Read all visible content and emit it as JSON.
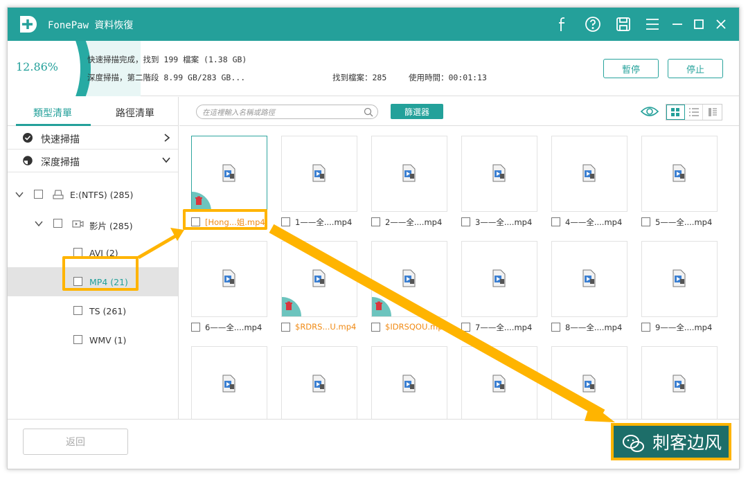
{
  "app": {
    "title": "FonePaw 資料恢復"
  },
  "titlebar": {
    "icons": [
      "facebook-icon",
      "help-icon",
      "save-icon",
      "menu-icon",
      "minimize-icon",
      "maximize-icon",
      "close-icon"
    ]
  },
  "status": {
    "percent": "12.86%",
    "line1": "快速掃描完成，找到 199 檔案 (1.38 GB)",
    "line2": "深度掃描，第二階段 8.99 GB/283 GB...",
    "found_label": "找到檔案：285",
    "time_label": "使用時間：00:01:13",
    "pause": "暫停",
    "stop": "停止"
  },
  "sidebar": {
    "tabs": [
      "類型清單",
      "路徑清單"
    ],
    "quick_scan": "快速掃描",
    "deep_scan": "深度掃描",
    "drive": "E:(NTFS) (285)",
    "video": "影片 (285)",
    "types": [
      "AVI (2)",
      "MP4 (21)",
      "TS (261)",
      "WMV (1)"
    ]
  },
  "toolbar": {
    "search_placeholder": "在這裡輸入名稱或路徑",
    "filter": "篩選器"
  },
  "files": [
    {
      "name": "[Hong...姐.mp4",
      "deleted": true,
      "orange": true
    },
    {
      "name": "1——全....mp4",
      "deleted": false,
      "orange": false
    },
    {
      "name": "2——全....mp4",
      "deleted": false,
      "orange": false
    },
    {
      "name": "3——全....mp4",
      "deleted": false,
      "orange": false
    },
    {
      "name": "4——全....mp4",
      "deleted": false,
      "orange": false
    },
    {
      "name": "5——全....mp4",
      "deleted": false,
      "orange": false
    },
    {
      "name": "6——全....mp4",
      "deleted": false,
      "orange": false
    },
    {
      "name": "$RDRS...U.mp4",
      "deleted": true,
      "orange": true
    },
    {
      "name": "$IDRSQOU.mp4",
      "deleted": true,
      "orange": true
    },
    {
      "name": "7——全....mp4",
      "deleted": false,
      "orange": false
    },
    {
      "name": "8——全....mp4",
      "deleted": false,
      "orange": false
    },
    {
      "name": "9——全....mp4",
      "deleted": false,
      "orange": false
    }
  ],
  "footer": {
    "back": "返回"
  },
  "watermark": {
    "text": "刺客边风"
  },
  "colors": {
    "accent": "#24a09a",
    "highlight": "#ffb400",
    "deleted_text": "#f08a14"
  }
}
